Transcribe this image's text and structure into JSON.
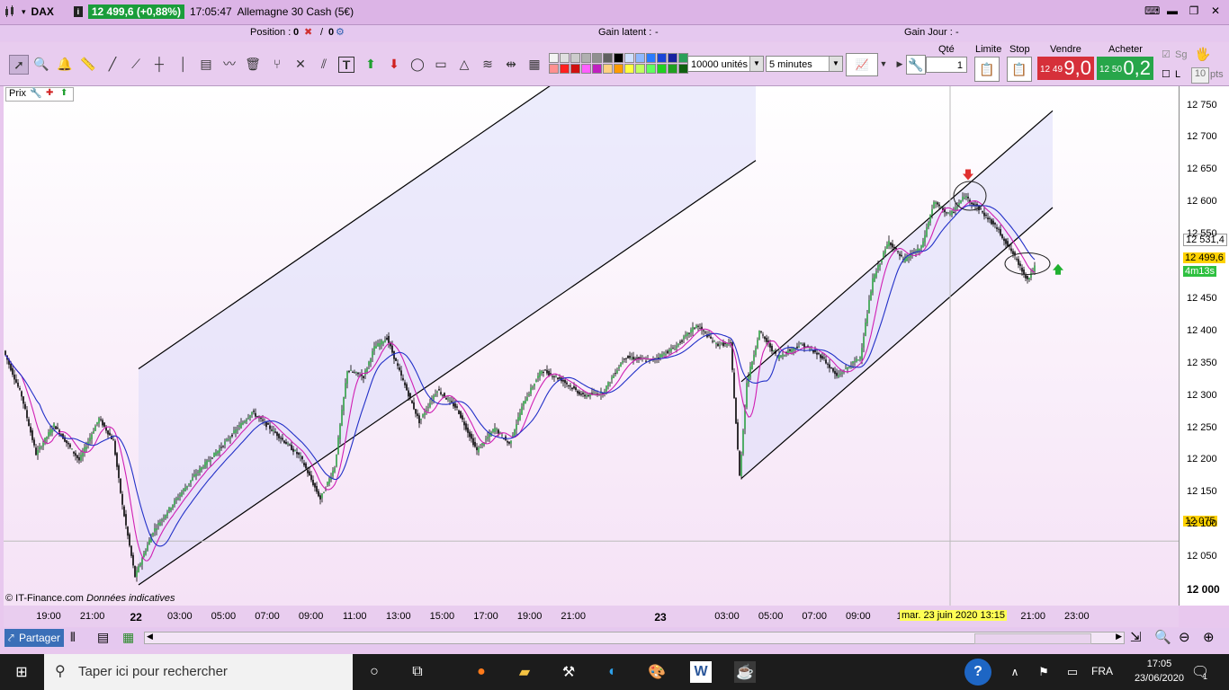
{
  "title_bar": {
    "symbol": "DAX",
    "price_badge": "12 499,6 (+0,88%)",
    "time": "17:05:47",
    "instrument": "Allemagne 30 Cash (5€)"
  },
  "info_bar": {
    "position_label": "Position :",
    "position_value": "0",
    "position_sep": "/",
    "position_pending": "0",
    "gain_latent_label": "Gain latent :",
    "gain_latent_value": "-",
    "gain_jour_label": "Gain Jour :",
    "gain_jour_value": "-"
  },
  "toolbar": {
    "units_select": "10000 unités",
    "timeframe_select": "5 minutes",
    "qte_label": "Qté",
    "qte_value": "1",
    "limite_label": "Limite",
    "stop_label": "Stop",
    "vendre_label": "Vendre",
    "acheter_label": "Acheter",
    "sell_small": "12 49",
    "sell_big": "9,0",
    "buy_small": "12 50",
    "buy_big": "0,2",
    "sg_label": "Sg",
    "l_label": "L",
    "pts_value": "10",
    "pts_label": "pts",
    "palette": [
      "#f4f4f4",
      "#e0e0e0",
      "#cccccc",
      "#b0b0b0",
      "#909090",
      "#606060",
      "#000000",
      "#cfe0ff",
      "#8fb8ff",
      "#2a7bff",
      "#1a44d8",
      "#1822a0",
      "#2aa05a",
      "#ff9090",
      "#ff2020",
      "#d01010",
      "#ff60ff",
      "#c020c0",
      "#ffd080",
      "#ff9a00",
      "#ffff40",
      "#c0ff60",
      "#60ff60",
      "#20d020",
      "#20a020",
      "#106010"
    ]
  },
  "chart": {
    "panel_label": "Prix",
    "copyright": "© IT-Finance.com",
    "disclaimer": "Données indicatives",
    "current_price_badge": "12 499,6",
    "countdown_badge": "4m13s",
    "ma_badge": "12 531,4",
    "crosshair_badge": "12 075",
    "cursor_date": "mar. 23 juin 2020 13:15",
    "y_ticks": [
      "12 750",
      "12 700",
      "12 650",
      "12 600",
      "12 550",
      "12 450",
      "12 400",
      "12 350",
      "12 300",
      "12 250",
      "12 200",
      "12 150",
      "12 100",
      "12 050",
      "12 000"
    ],
    "x_ticks": [
      "19:00",
      "21:00",
      "22",
      "03:00",
      "05:00",
      "07:00",
      "09:00",
      "11:00",
      "13:00",
      "15:00",
      "17:00",
      "19:00",
      "21:00",
      "23",
      "03:00",
      "05:00",
      "07:00",
      "09:00",
      "11",
      "17:00",
      "19:00",
      "21:00",
      "23:00"
    ],
    "x_tick_bold": [
      false,
      false,
      true,
      false,
      false,
      false,
      false,
      false,
      false,
      false,
      false,
      false,
      false,
      true,
      false,
      false,
      false,
      false,
      false,
      false,
      false,
      false,
      false
    ],
    "colors": {
      "candle_up": "#2ea043",
      "candle_down": "#000000",
      "ma_fast": "#d01fb4",
      "ma_slow": "#2230c8",
      "channel_fill": "#dcdcfa",
      "arrow_down": "#e03030",
      "arrow_up": "#20b030"
    }
  },
  "chart_data": {
    "type": "line",
    "title": "",
    "xlabel": "",
    "ylabel": "",
    "ylim": [
      11975,
      12780
    ],
    "x_range": [
      "2020-06-21 18:15",
      "2020-06-23 17:05"
    ],
    "series": [
      {
        "key": "price",
        "values": [
          [
            0,
            12370
          ],
          [
            20,
            12300
          ],
          [
            36,
            12210
          ],
          [
            56,
            12255
          ],
          [
            84,
            12200
          ],
          [
            106,
            12265
          ],
          [
            122,
            12230
          ],
          [
            132,
            12130
          ],
          [
            146,
            12020
          ],
          [
            166,
            12090
          ],
          [
            192,
            12140
          ],
          [
            214,
            12180
          ],
          [
            238,
            12215
          ],
          [
            276,
            12275
          ],
          [
            304,
            12240
          ],
          [
            330,
            12205
          ],
          [
            352,
            12140
          ],
          [
            368,
            12190
          ],
          [
            382,
            12340
          ],
          [
            400,
            12330
          ],
          [
            412,
            12375
          ],
          [
            426,
            12390
          ],
          [
            442,
            12330
          ],
          [
            462,
            12260
          ],
          [
            482,
            12310
          ],
          [
            504,
            12280
          ],
          [
            526,
            12215
          ],
          [
            546,
            12250
          ],
          [
            562,
            12225
          ],
          [
            578,
            12290
          ],
          [
            598,
            12340
          ],
          [
            620,
            12325
          ],
          [
            644,
            12300
          ],
          [
            666,
            12305
          ],
          [
            690,
            12360
          ],
          [
            720,
            12355
          ],
          [
            746,
            12375
          ],
          [
            770,
            12410
          ],
          [
            792,
            12380
          ],
          [
            808,
            12380
          ],
          [
            818,
            12175
          ],
          [
            826,
            12320
          ],
          [
            840,
            12400
          ],
          [
            860,
            12360
          ],
          [
            886,
            12380
          ],
          [
            910,
            12360
          ],
          [
            926,
            12330
          ],
          [
            952,
            12360
          ],
          [
            966,
            12480
          ],
          [
            984,
            12540
          ],
          [
            1000,
            12510
          ],
          [
            1020,
            12530
          ],
          [
            1034,
            12600
          ],
          [
            1052,
            12580
          ],
          [
            1068,
            12610
          ],
          [
            1084,
            12590
          ],
          [
            1104,
            12560
          ],
          [
            1122,
            12520
          ],
          [
            1138,
            12480
          ],
          [
            1146,
            12500
          ]
        ]
      }
    ],
    "channels": [
      {
        "start": [
          150,
          12007
        ],
        "end": [
          836,
          12665
        ],
        "width_pts": 335
      },
      {
        "start": [
          820,
          12172
        ],
        "end": [
          1166,
          12592
        ],
        "width_pts": 150
      }
    ],
    "annotations": [
      {
        "type": "ellipse",
        "at": [
          1074,
          12610
        ]
      },
      {
        "type": "ellipse",
        "at": [
          1138,
          12505
        ]
      },
      {
        "type": "arrow_down",
        "at": [
          1072,
          12640
        ]
      },
      {
        "type": "arrow_up",
        "at": [
          1172,
          12499
        ]
      }
    ]
  },
  "bottom_bar": {
    "share_label": "Partager"
  },
  "taskbar": {
    "search_placeholder": "Taper ici pour rechercher",
    "lang": "FRA",
    "time": "17:05",
    "date": "23/06/2020",
    "notif_count": "1"
  }
}
